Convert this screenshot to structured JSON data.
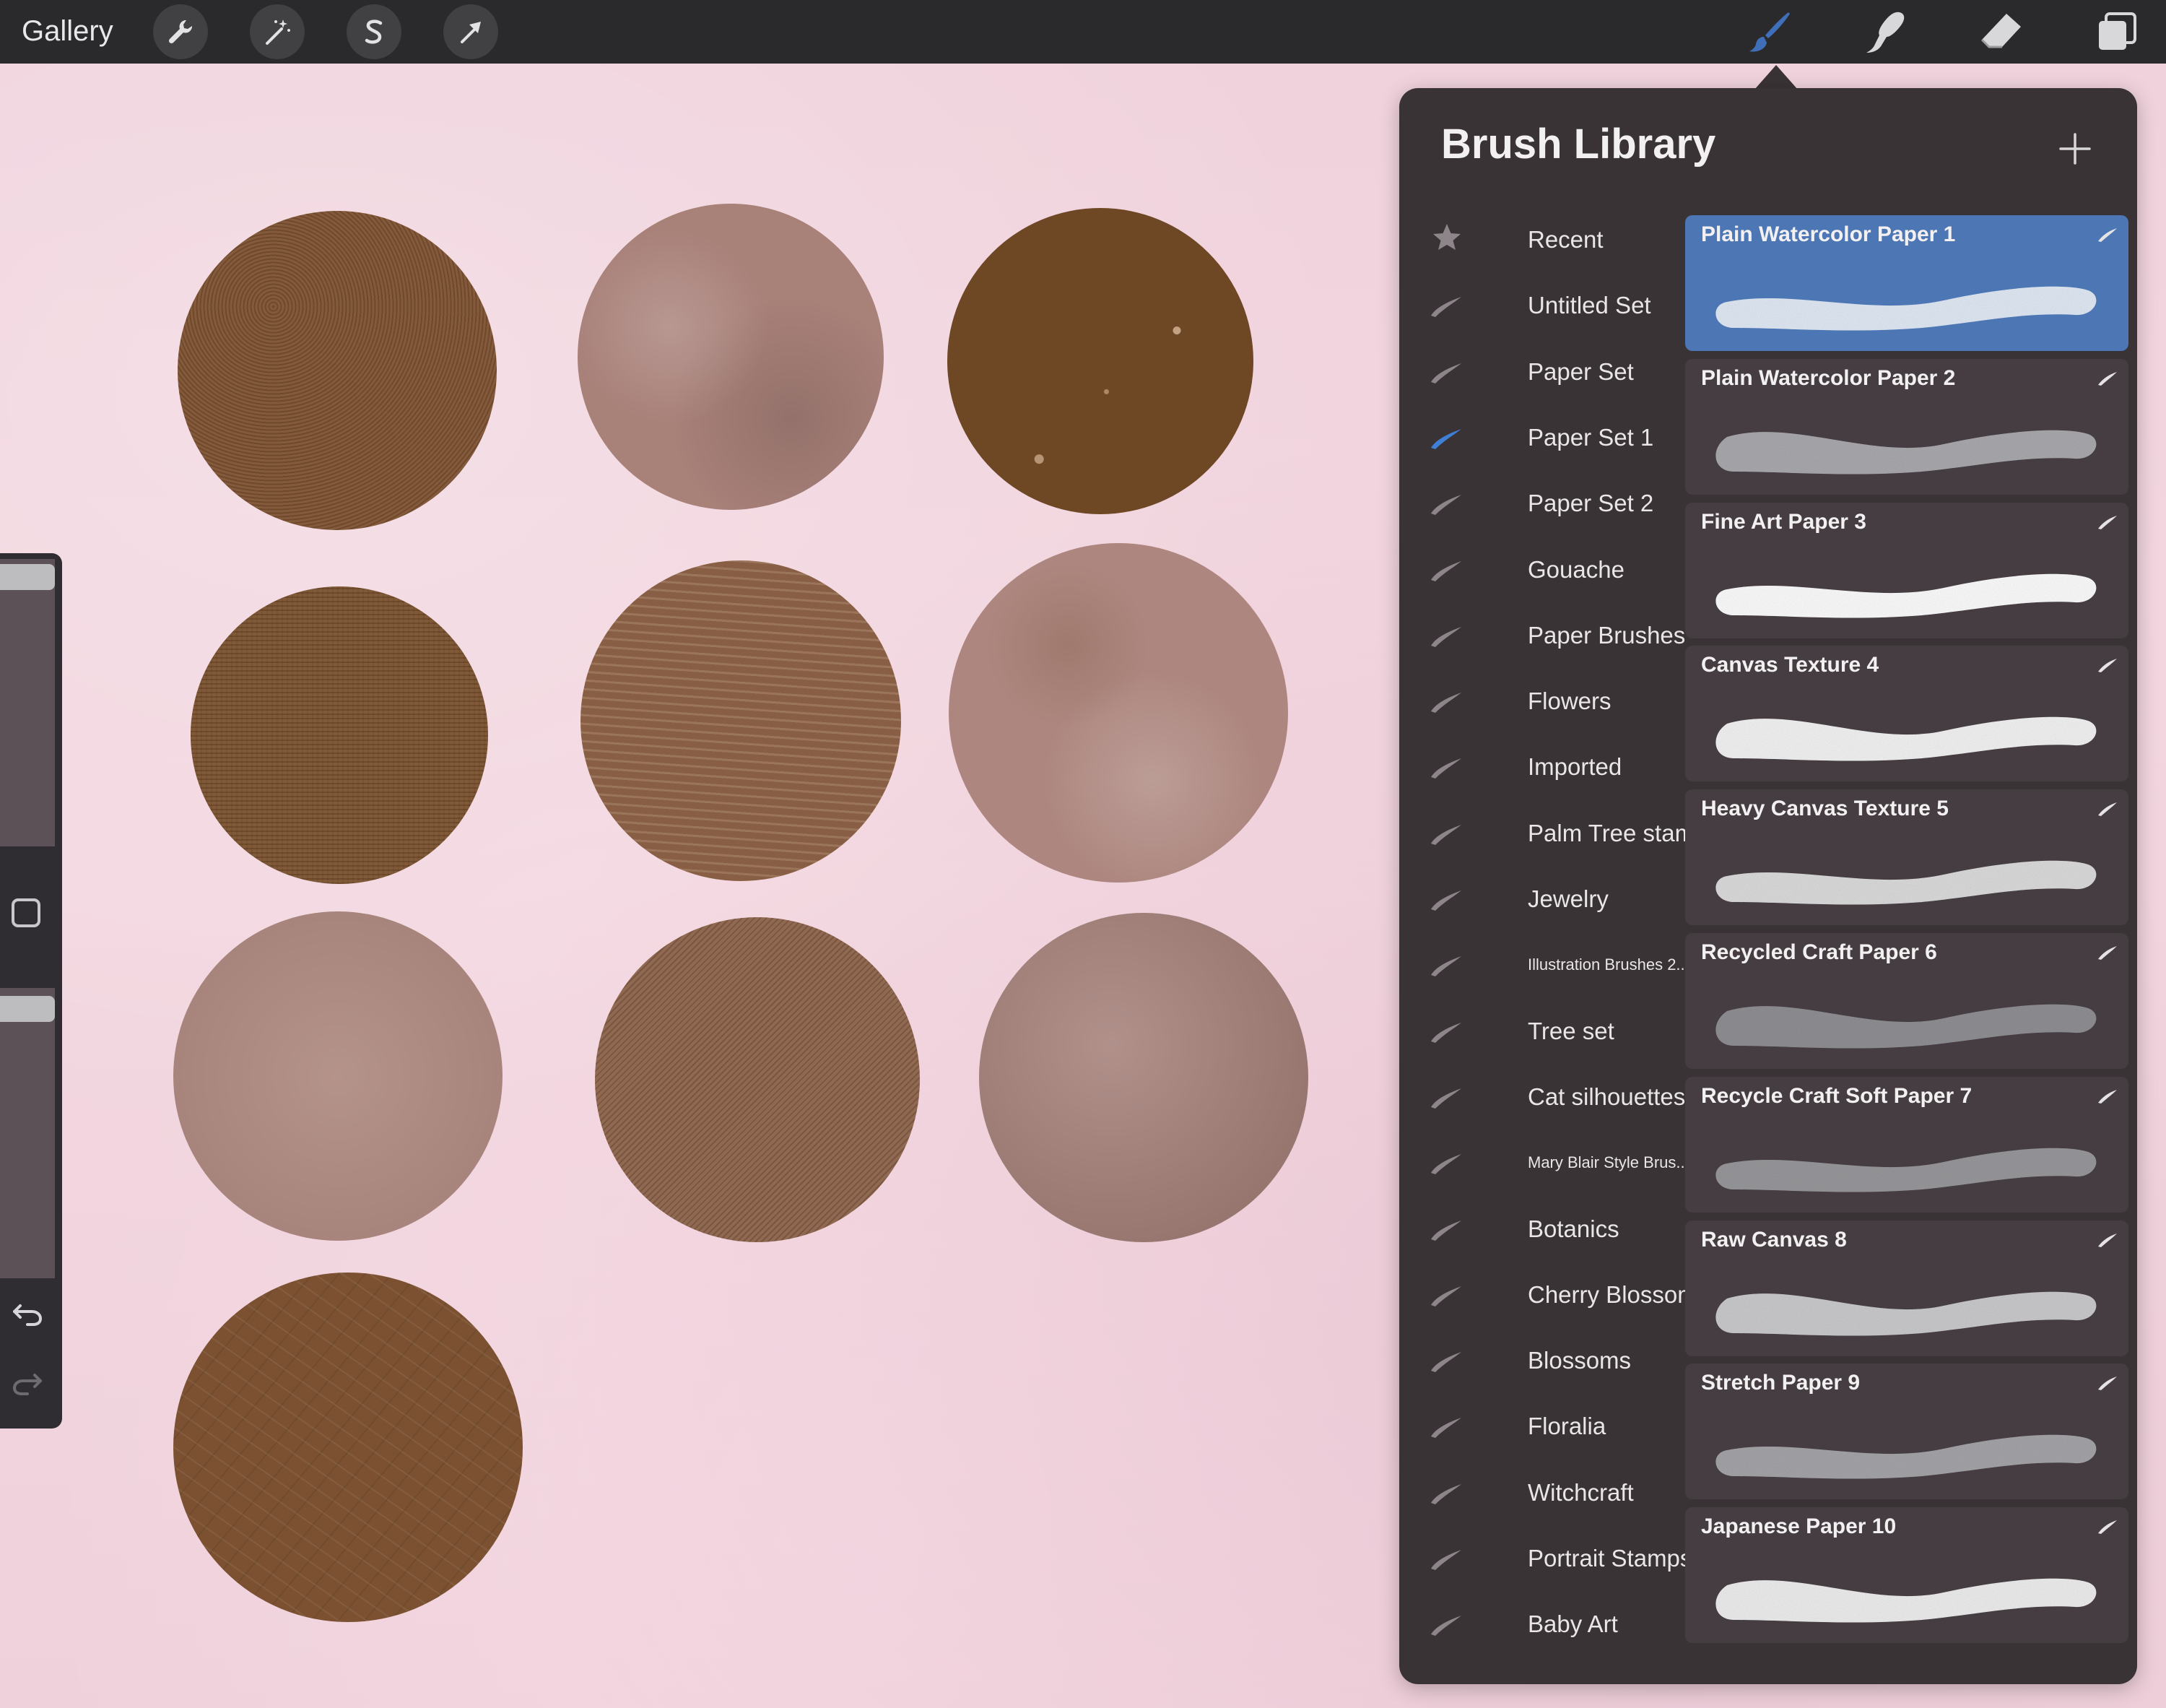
{
  "topbar": {
    "gallery_label": "Gallery",
    "left_tools": [
      "wrench-icon",
      "magic-wand-icon",
      "selection-s-icon",
      "transform-arrow-icon"
    ],
    "right_tools": [
      "brush-icon",
      "smudge-icon",
      "eraser-icon",
      "layers-icon"
    ],
    "active_tool": "brush-icon",
    "active_color": "#3f6fb8"
  },
  "panel": {
    "title": "Brush Library",
    "add_icon": "plus-icon",
    "sets": [
      {
        "label": "Recent",
        "icon": "star-icon"
      },
      {
        "label": "Untitled Set",
        "icon": "brush-stroke-icon"
      },
      {
        "label": "Paper Set",
        "icon": "brush-stroke-icon"
      },
      {
        "label": "Paper Set 1",
        "icon": "brush-stroke-icon",
        "selected": true
      },
      {
        "label": "Paper Set 2",
        "icon": "brush-stroke-icon"
      },
      {
        "label": "Gouache",
        "icon": "brush-stroke-icon"
      },
      {
        "label": "Paper Brushes",
        "icon": "brush-stroke-icon"
      },
      {
        "label": "Flowers",
        "icon": "brush-stroke-icon"
      },
      {
        "label": "Imported",
        "icon": "brush-stroke-icon"
      },
      {
        "label": "Palm Tree stamps",
        "icon": "brush-stroke-icon"
      },
      {
        "label": "Jewelry",
        "icon": "brush-stroke-icon"
      },
      {
        "label": "Illustration Brushes 2...",
        "icon": "brush-stroke-icon"
      },
      {
        "label": "Tree set",
        "icon": "brush-stroke-icon"
      },
      {
        "label": "Cat silhouettes",
        "icon": "brush-stroke-icon"
      },
      {
        "label": "Mary Blair Style Brus...",
        "icon": "brush-stroke-icon"
      },
      {
        "label": "Botanics",
        "icon": "brush-stroke-icon"
      },
      {
        "label": "Cherry Blossom",
        "icon": "brush-stroke-icon"
      },
      {
        "label": "Blossoms",
        "icon": "brush-stroke-icon"
      },
      {
        "label": "Floralia",
        "icon": "brush-stroke-icon"
      },
      {
        "label": "Witchcraft",
        "icon": "brush-stroke-icon"
      },
      {
        "label": "Portrait Stamps",
        "icon": "brush-stroke-icon"
      },
      {
        "label": "Baby Art",
        "icon": "brush-stroke-icon"
      }
    ],
    "brushes": [
      {
        "name": "Plain Watercolor Paper 1",
        "selected": true,
        "stroke_color": "#dfe8f3"
      },
      {
        "name": "Plain Watercolor Paper 2",
        "stroke_color": "#a9a9ad"
      },
      {
        "name": "Fine Art Paper 3",
        "stroke_color": "#fbfbfb"
      },
      {
        "name": "Canvas Texture 4",
        "stroke_color": "#f1f1f1"
      },
      {
        "name": "Heavy Canvas Texture 5",
        "stroke_color": "#dadada"
      },
      {
        "name": "Recycled Craft Paper 6",
        "stroke_color": "#8f8f93"
      },
      {
        "name": "Recycle Craft Soft Paper 7",
        "stroke_color": "#97979b"
      },
      {
        "name": "Raw Canvas 8",
        "stroke_color": "#c9c9cc"
      },
      {
        "name": "Stretch Paper 9",
        "stroke_color": "#a4a4a8"
      },
      {
        "name": "Japanese Paper 10",
        "stroke_color": "#ececec"
      }
    ]
  },
  "sidebar": {
    "brush_size_level": 0.02,
    "opacity_level": 0.03,
    "modify_icon": "square-modify-icon",
    "undo_icon": "undo-icon",
    "redo_icon": "redo-icon"
  },
  "canvas": {
    "swatches": [
      {
        "color": "#7d5131",
        "texture": "leather"
      },
      {
        "color": "#a88179",
        "texture": "mottled"
      },
      {
        "color": "#6e4725",
        "texture": "speckled"
      },
      {
        "color": "#7a5230",
        "texture": "linen"
      },
      {
        "color": "#906548",
        "texture": "canvas"
      },
      {
        "color": "#ad877f",
        "texture": "stained"
      },
      {
        "color": "#ae8a81",
        "texture": "smooth"
      },
      {
        "color": "#886047",
        "texture": "twill"
      },
      {
        "color": "#a6817a",
        "texture": "grainy"
      },
      {
        "color": "#7b5131",
        "texture": "crinkled"
      }
    ]
  }
}
